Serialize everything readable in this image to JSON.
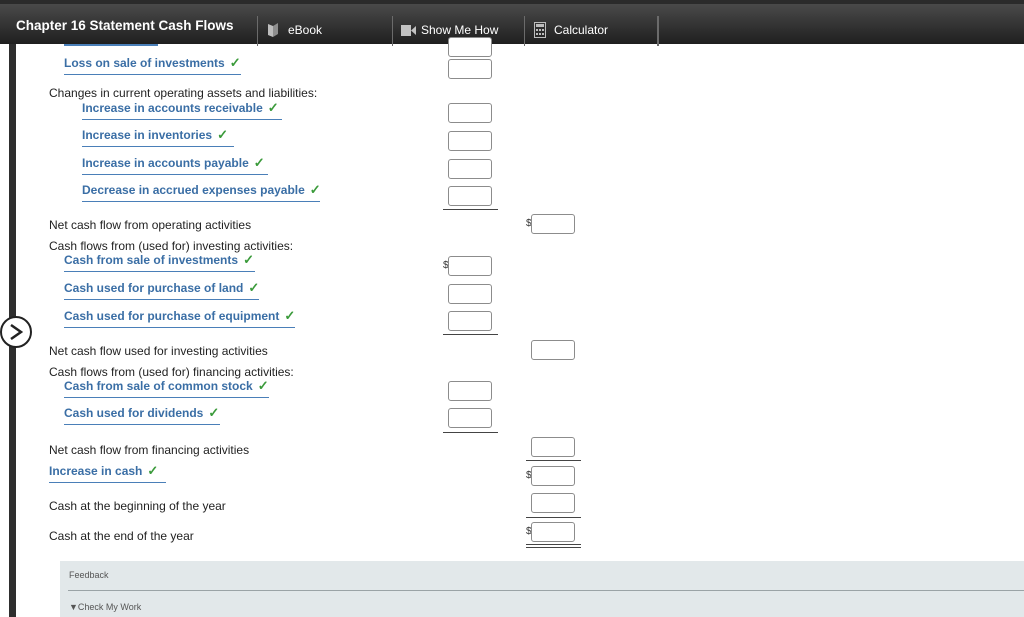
{
  "header": {
    "title": "Chapter 16 Statement Cash Flows",
    "tabs": [
      {
        "label": "eBook",
        "icon": "book-icon"
      },
      {
        "label": "Show Me How",
        "icon": "video-icon"
      },
      {
        "label": "Calculator",
        "icon": "calculator-icon"
      }
    ]
  },
  "rows": {
    "loss_sale": "Loss on sale of investments",
    "changes_heading": "Changes in current operating assets and liabilities:",
    "inc_ar": "Increase in accounts receivable",
    "inc_inv": "Increase in inventories",
    "inc_ap": "Increase in accounts payable",
    "dec_accrued": "Decrease in accrued expenses payable",
    "net_operating": "Net cash flow from operating activities",
    "investing_heading": "Cash flows from (used for) investing activities:",
    "cash_sale_inv": "Cash from sale of investments",
    "cash_land": "Cash used for purchase of land",
    "cash_equipment": "Cash used for purchase of equipment",
    "net_investing": "Net cash flow used for investing activities",
    "financing_heading": "Cash flows from (used for) financing activities:",
    "cash_common": "Cash from sale of common stock",
    "cash_dividends": "Cash used for dividends",
    "net_financing": "Net cash flow from financing activities",
    "increase_cash": "Increase in cash",
    "cash_beginning": "Cash at the beginning of the year",
    "cash_end": "Cash at the end of the year"
  },
  "currency_symbol": "$",
  "check_mark": "✓",
  "feedback": {
    "title": "Feedback",
    "check_my_work": "▼Check My Work"
  }
}
